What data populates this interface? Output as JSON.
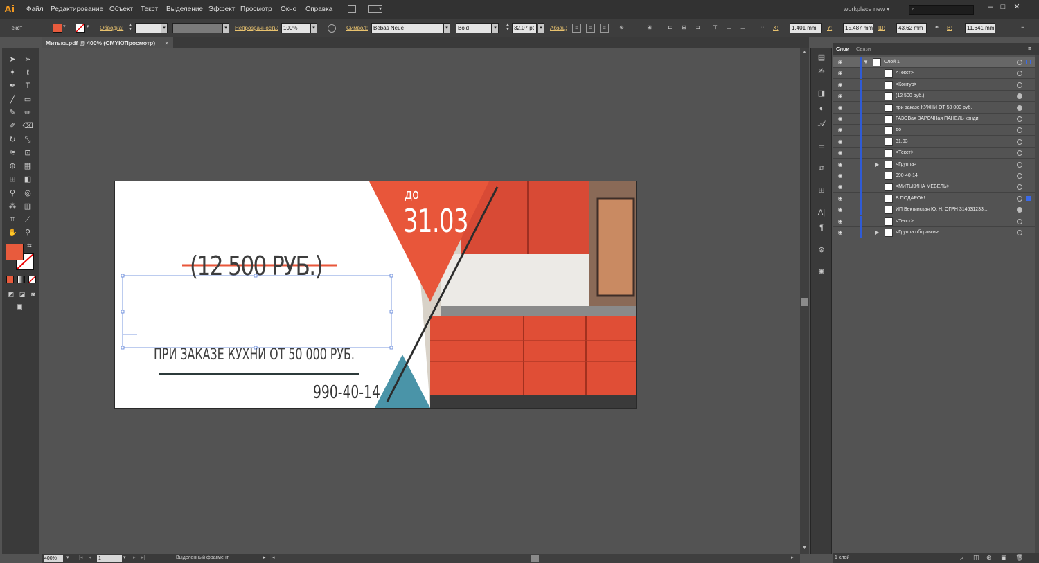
{
  "app": {
    "logo": "Ai",
    "workspace": "workplace new"
  },
  "menu": [
    "Файл",
    "Редактирование",
    "Объект",
    "Текст",
    "Выделение",
    "Эффект",
    "Просмотр",
    "Окно",
    "Справка"
  ],
  "control": {
    "label_text": "Текст",
    "stroke_label": "Обводка:",
    "opacity_label": "Непрозрачность:",
    "opacity_value": "100%",
    "char_label": "Символ:",
    "font_name": "Bebas Neue",
    "font_style": "Bold",
    "font_size": "32,07 pt",
    "para_label": "Абзац:",
    "x_label": "X:",
    "x_value": "1,401 mm",
    "y_label": "Y:",
    "y_value": "15,487 mm",
    "w_label": "Ш:",
    "w_value": "43,62 mm",
    "h_label": "В:",
    "h_value": "11,641 mm",
    "fill_color": "#e85b3d"
  },
  "document": {
    "tab": "Митька.pdf @ 400% (CMYK/Просмотр)"
  },
  "artboard": {
    "old_price": "(12 500 РУБ.)",
    "condition": "ПРИ ЗАКАЗЕ КУХНИ ОТ 50 000 РУБ.",
    "phone": "990-40-14",
    "until_label": "до",
    "until_date": "31.03",
    "accent": "#e8563a",
    "teal": "#4a94a8"
  },
  "status": {
    "zoom": "400%",
    "page": "1",
    "mode": "Выделенный фрагмент"
  },
  "layers_panel": {
    "tabs": [
      "Слои",
      "Связи"
    ],
    "layers": [
      "Слой 1",
      "<Текст>",
      "<Контур>",
      "(12 500 руб.)",
      "при заказе КУХНИ ОТ 50 000 руб.",
      "ГАЗОВая ВАРОЧНая  ПАНЕЛЬ канди",
      "до",
      "31.03",
      "<Текст>",
      "<Группа>",
      "990-40-14",
      "<МИТЬКИНА МЕБЕЛЬ>",
      "В ПОДАРОК!",
      "ИП Вектинская Ю. Н. ОГРН 314631233...",
      "<Текст>",
      "<Группа обтравки>"
    ],
    "footer": "1 слой"
  }
}
